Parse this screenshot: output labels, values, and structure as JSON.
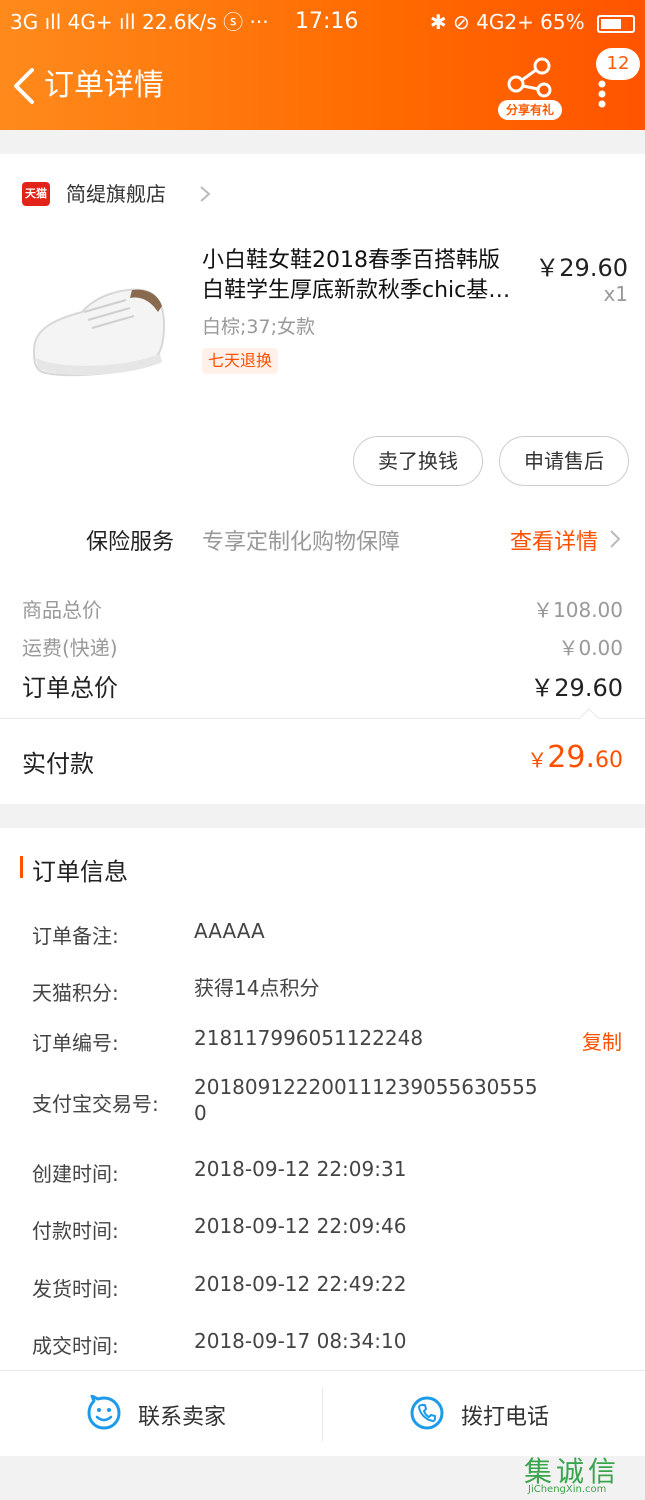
{
  "status_bar": {
    "left": "3G ıll 4G+ ıll 22.6K/s ⓢ ···",
    "time": "17:16",
    "right": "✱ ⊘ 4G2+ 65%",
    "battery_level": 0.65
  },
  "navbar": {
    "title": "订单详情",
    "share_label": "分享有礼",
    "badge_count": "12"
  },
  "shop": {
    "name": "简缇旗舰店",
    "platform_icon_text": "天猫"
  },
  "product": {
    "title_line1": "小白鞋女鞋2018春季百搭韩版",
    "title_line2": "白鞋学生厚底新款秋季chic基…",
    "price": "￥29.60",
    "qty": "x1",
    "sku": "白棕;37;女款",
    "tag": "七天退换"
  },
  "actions": {
    "sell_button": "卖了换钱",
    "aftersale_button": "申请售后"
  },
  "insurance": {
    "title": "保险服务",
    "desc": "专享定制化购物保障",
    "link": "查看详情"
  },
  "fees": {
    "goods_label": "商品总价",
    "goods_value": "￥108.00",
    "shipping_label": "运费(快递)",
    "shipping_value": "￥0.00",
    "total_label": "订单总价",
    "total_value": "￥29.60",
    "paid_label": "实付款",
    "paid_currency": "￥",
    "paid_int": "29.",
    "paid_dec": "60"
  },
  "order_info": {
    "title": "订单信息",
    "copy_label": "复制",
    "rows": [
      {
        "label": "订单备注:",
        "value": "AAAAA"
      },
      {
        "label": "天猫积分:",
        "value": "获得14点积分"
      },
      {
        "label": "订单编号:",
        "value": "218117996051122248"
      },
      {
        "label": "支付宝交易号:",
        "value": "20180912220011123905563055​50"
      },
      {
        "label": "创建时间:",
        "value": "2018-09-12 22:09:31"
      },
      {
        "label": "付款时间:",
        "value": "2018-09-12 22:09:46"
      },
      {
        "label": "发货时间:",
        "value": "2018-09-12 22:49:22"
      },
      {
        "label": "成交时间:",
        "value": "2018-09-17 08:34:10"
      }
    ]
  },
  "bottom": {
    "contact_seller": "联系卖家",
    "call_phone": "拨打电话"
  },
  "watermark": {
    "text": "集诚信",
    "sub": "JiChengXin.com"
  },
  "colors": {
    "accent": "#ff5000",
    "header_start": "#ff8a1c",
    "header_end": "#ff5400",
    "icon_blue": "#1e9be8"
  }
}
